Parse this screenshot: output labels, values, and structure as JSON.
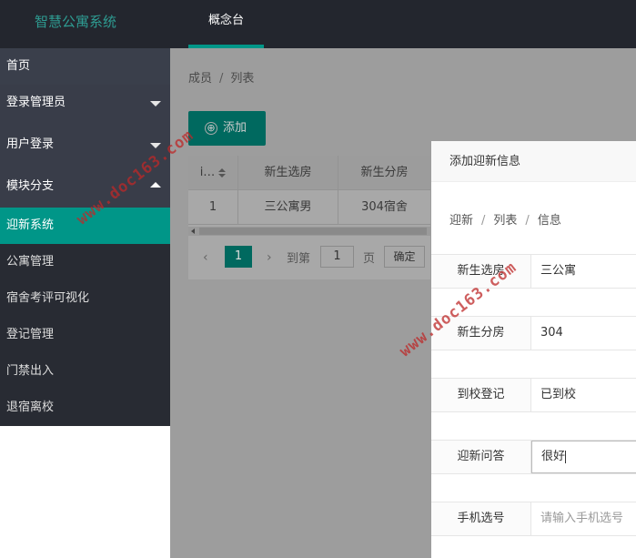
{
  "app": {
    "title": "智慧公寓系统",
    "top_tab": "概念台"
  },
  "sidebar": {
    "items": [
      {
        "label": "首页"
      },
      {
        "label": "登录管理员"
      },
      {
        "label": "用户登录"
      },
      {
        "label": "模块分支"
      },
      {
        "label": "迎新系统"
      },
      {
        "label": "公寓管理"
      },
      {
        "label": "宿舍考评可视化"
      },
      {
        "label": "登记管理"
      },
      {
        "label": "门禁出入"
      },
      {
        "label": "退宿离校"
      }
    ]
  },
  "main": {
    "breadcrumb": [
      "成员",
      "列表"
    ],
    "add_button": "添加",
    "add_icon": "⊕",
    "table": {
      "headers": [
        "i…",
        "新生选房",
        "新生分房"
      ],
      "rows": [
        [
          "1",
          "三公寓男",
          "304宿舍"
        ]
      ]
    },
    "pager": {
      "current": "1",
      "goto_label": "到第",
      "page_input": "1",
      "page_unit": "页",
      "confirm": "确定",
      "prev": "‹",
      "next": "›"
    }
  },
  "panel": {
    "title": "添加迎新信息",
    "breadcrumb": [
      "迎新",
      "列表",
      "信息"
    ],
    "fields": [
      {
        "label": "新生选房",
        "value": "三公寓",
        "placeholder": ""
      },
      {
        "label": "新生分房",
        "value": "304",
        "placeholder": ""
      },
      {
        "label": "到校登记",
        "value": "已到校",
        "placeholder": ""
      },
      {
        "label": "迎新问答",
        "value": "很好",
        "placeholder": ""
      },
      {
        "label": "手机选号",
        "value": "",
        "placeholder": "请输入手机选号"
      }
    ]
  },
  "watermark": "www.doc163.com"
}
